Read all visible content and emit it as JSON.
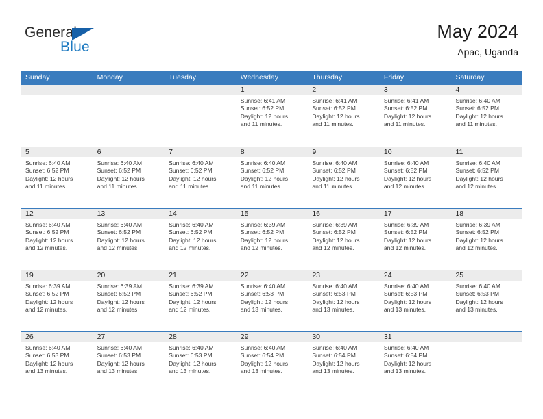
{
  "brand": {
    "general": "General",
    "blue": "Blue",
    "flag_icon": "flag-triangle-icon"
  },
  "header": {
    "title": "May 2024",
    "subtitle": "Apac, Uganda"
  },
  "colors": {
    "header_blue": "#3a7cbe",
    "brand_blue": "#1c79c0",
    "daynum_strip": "#ececec",
    "text": "#3b3b3b"
  },
  "weekdays": [
    "Sunday",
    "Monday",
    "Tuesday",
    "Wednesday",
    "Thursday",
    "Friday",
    "Saturday"
  ],
  "labels": {
    "sunrise_prefix": "Sunrise:",
    "sunset_prefix": "Sunset:",
    "daylight_prefix": "Daylight:"
  },
  "weeks": [
    [
      {
        "day": "",
        "empty": true
      },
      {
        "day": "",
        "empty": true
      },
      {
        "day": "",
        "empty": true
      },
      {
        "day": "1",
        "sunrise": "Sunrise: 6:41 AM",
        "sunset": "Sunset: 6:52 PM",
        "daylight1": "Daylight: 12 hours",
        "daylight2": "and 11 minutes."
      },
      {
        "day": "2",
        "sunrise": "Sunrise: 6:41 AM",
        "sunset": "Sunset: 6:52 PM",
        "daylight1": "Daylight: 12 hours",
        "daylight2": "and 11 minutes."
      },
      {
        "day": "3",
        "sunrise": "Sunrise: 6:41 AM",
        "sunset": "Sunset: 6:52 PM",
        "daylight1": "Daylight: 12 hours",
        "daylight2": "and 11 minutes."
      },
      {
        "day": "4",
        "sunrise": "Sunrise: 6:40 AM",
        "sunset": "Sunset: 6:52 PM",
        "daylight1": "Daylight: 12 hours",
        "daylight2": "and 11 minutes."
      }
    ],
    [
      {
        "day": "5",
        "sunrise": "Sunrise: 6:40 AM",
        "sunset": "Sunset: 6:52 PM",
        "daylight1": "Daylight: 12 hours",
        "daylight2": "and 11 minutes."
      },
      {
        "day": "6",
        "sunrise": "Sunrise: 6:40 AM",
        "sunset": "Sunset: 6:52 PM",
        "daylight1": "Daylight: 12 hours",
        "daylight2": "and 11 minutes."
      },
      {
        "day": "7",
        "sunrise": "Sunrise: 6:40 AM",
        "sunset": "Sunset: 6:52 PM",
        "daylight1": "Daylight: 12 hours",
        "daylight2": "and 11 minutes."
      },
      {
        "day": "8",
        "sunrise": "Sunrise: 6:40 AM",
        "sunset": "Sunset: 6:52 PM",
        "daylight1": "Daylight: 12 hours",
        "daylight2": "and 11 minutes."
      },
      {
        "day": "9",
        "sunrise": "Sunrise: 6:40 AM",
        "sunset": "Sunset: 6:52 PM",
        "daylight1": "Daylight: 12 hours",
        "daylight2": "and 11 minutes."
      },
      {
        "day": "10",
        "sunrise": "Sunrise: 6:40 AM",
        "sunset": "Sunset: 6:52 PM",
        "daylight1": "Daylight: 12 hours",
        "daylight2": "and 12 minutes."
      },
      {
        "day": "11",
        "sunrise": "Sunrise: 6:40 AM",
        "sunset": "Sunset: 6:52 PM",
        "daylight1": "Daylight: 12 hours",
        "daylight2": "and 12 minutes."
      }
    ],
    [
      {
        "day": "12",
        "sunrise": "Sunrise: 6:40 AM",
        "sunset": "Sunset: 6:52 PM",
        "daylight1": "Daylight: 12 hours",
        "daylight2": "and 12 minutes."
      },
      {
        "day": "13",
        "sunrise": "Sunrise: 6:40 AM",
        "sunset": "Sunset: 6:52 PM",
        "daylight1": "Daylight: 12 hours",
        "daylight2": "and 12 minutes."
      },
      {
        "day": "14",
        "sunrise": "Sunrise: 6:40 AM",
        "sunset": "Sunset: 6:52 PM",
        "daylight1": "Daylight: 12 hours",
        "daylight2": "and 12 minutes."
      },
      {
        "day": "15",
        "sunrise": "Sunrise: 6:39 AM",
        "sunset": "Sunset: 6:52 PM",
        "daylight1": "Daylight: 12 hours",
        "daylight2": "and 12 minutes."
      },
      {
        "day": "16",
        "sunrise": "Sunrise: 6:39 AM",
        "sunset": "Sunset: 6:52 PM",
        "daylight1": "Daylight: 12 hours",
        "daylight2": "and 12 minutes."
      },
      {
        "day": "17",
        "sunrise": "Sunrise: 6:39 AM",
        "sunset": "Sunset: 6:52 PM",
        "daylight1": "Daylight: 12 hours",
        "daylight2": "and 12 minutes."
      },
      {
        "day": "18",
        "sunrise": "Sunrise: 6:39 AM",
        "sunset": "Sunset: 6:52 PM",
        "daylight1": "Daylight: 12 hours",
        "daylight2": "and 12 minutes."
      }
    ],
    [
      {
        "day": "19",
        "sunrise": "Sunrise: 6:39 AM",
        "sunset": "Sunset: 6:52 PM",
        "daylight1": "Daylight: 12 hours",
        "daylight2": "and 12 minutes."
      },
      {
        "day": "20",
        "sunrise": "Sunrise: 6:39 AM",
        "sunset": "Sunset: 6:52 PM",
        "daylight1": "Daylight: 12 hours",
        "daylight2": "and 12 minutes."
      },
      {
        "day": "21",
        "sunrise": "Sunrise: 6:39 AM",
        "sunset": "Sunset: 6:52 PM",
        "daylight1": "Daylight: 12 hours",
        "daylight2": "and 12 minutes."
      },
      {
        "day": "22",
        "sunrise": "Sunrise: 6:40 AM",
        "sunset": "Sunset: 6:53 PM",
        "daylight1": "Daylight: 12 hours",
        "daylight2": "and 13 minutes."
      },
      {
        "day": "23",
        "sunrise": "Sunrise: 6:40 AM",
        "sunset": "Sunset: 6:53 PM",
        "daylight1": "Daylight: 12 hours",
        "daylight2": "and 13 minutes."
      },
      {
        "day": "24",
        "sunrise": "Sunrise: 6:40 AM",
        "sunset": "Sunset: 6:53 PM",
        "daylight1": "Daylight: 12 hours",
        "daylight2": "and 13 minutes."
      },
      {
        "day": "25",
        "sunrise": "Sunrise: 6:40 AM",
        "sunset": "Sunset: 6:53 PM",
        "daylight1": "Daylight: 12 hours",
        "daylight2": "and 13 minutes."
      }
    ],
    [
      {
        "day": "26",
        "sunrise": "Sunrise: 6:40 AM",
        "sunset": "Sunset: 6:53 PM",
        "daylight1": "Daylight: 12 hours",
        "daylight2": "and 13 minutes."
      },
      {
        "day": "27",
        "sunrise": "Sunrise: 6:40 AM",
        "sunset": "Sunset: 6:53 PM",
        "daylight1": "Daylight: 12 hours",
        "daylight2": "and 13 minutes."
      },
      {
        "day": "28",
        "sunrise": "Sunrise: 6:40 AM",
        "sunset": "Sunset: 6:53 PM",
        "daylight1": "Daylight: 12 hours",
        "daylight2": "and 13 minutes."
      },
      {
        "day": "29",
        "sunrise": "Sunrise: 6:40 AM",
        "sunset": "Sunset: 6:54 PM",
        "daylight1": "Daylight: 12 hours",
        "daylight2": "and 13 minutes."
      },
      {
        "day": "30",
        "sunrise": "Sunrise: 6:40 AM",
        "sunset": "Sunset: 6:54 PM",
        "daylight1": "Daylight: 12 hours",
        "daylight2": "and 13 minutes."
      },
      {
        "day": "31",
        "sunrise": "Sunrise: 6:40 AM",
        "sunset": "Sunset: 6:54 PM",
        "daylight1": "Daylight: 12 hours",
        "daylight2": "and 13 minutes."
      },
      {
        "day": "",
        "empty": true
      }
    ]
  ]
}
